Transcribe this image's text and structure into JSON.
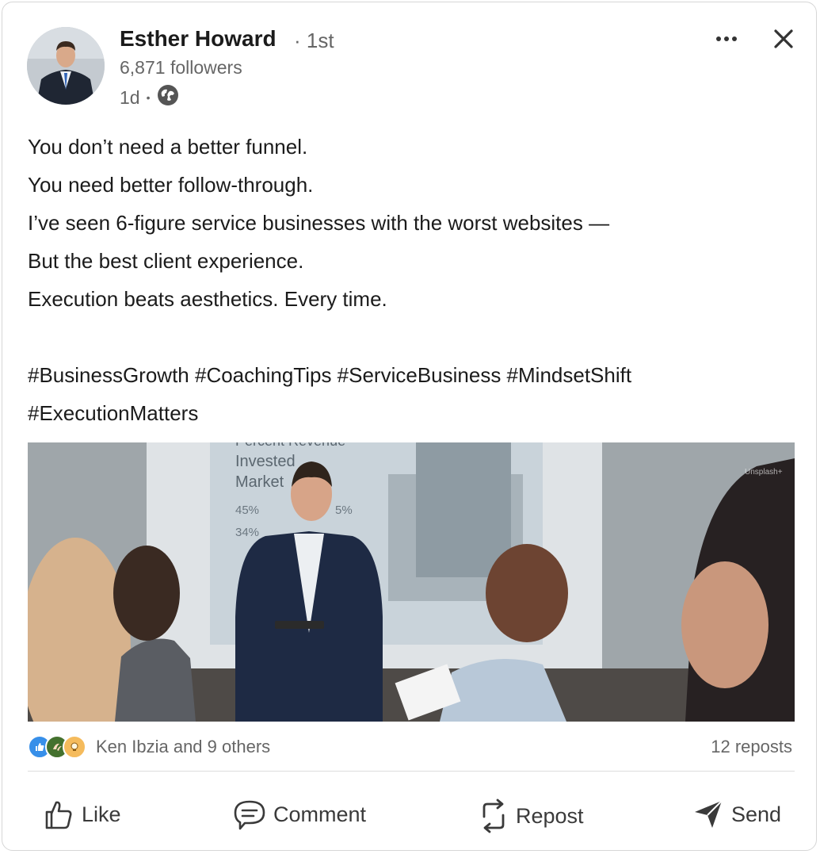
{
  "post": {
    "author": {
      "name": "Esther Howard",
      "degree": "· 1st",
      "followers": "6,871 followers",
      "time": "1d",
      "time_separator": "•",
      "visibility_icon": "globe-icon"
    },
    "menu_icon": "more-icon",
    "close_icon": "close-icon",
    "text_lines": [
      "You don’t need a better funnel.",
      "You need better follow-through.",
      "I’ve seen 6-figure service businesses with the worst websites —",
      "But the best client experience.",
      "Execution beats aesthetics. Every time."
    ],
    "hashtags_lines": [
      "#BusinessGrowth #CoachingTips #ServiceBusiness #MindsetShift",
      "#ExecutionMatters"
    ],
    "image": {
      "slide_lines": [
        "Percent Revenue",
        "Invested",
        "Market"
      ],
      "slide_stats": [
        "45%",
        "5%",
        "34%"
      ],
      "watermark": "Unsplash+"
    },
    "social": {
      "reaction_icons": [
        "like-icon",
        "celebrate-icon",
        "insightful-icon"
      ],
      "reactions_text": "Ken Ibzia and 9 others",
      "reposts_text": "12 reposts"
    },
    "actions": [
      {
        "label": "Like",
        "icon": "thumbs-up-icon"
      },
      {
        "label": "Comment",
        "icon": "comment-icon"
      },
      {
        "label": "Repost",
        "icon": "repost-icon"
      },
      {
        "label": "Send",
        "icon": "send-icon"
      }
    ],
    "colors": {
      "text": "#1b1b1b",
      "secondary": "#666666",
      "like_blue": "#378fe9",
      "celebrate_green": "#44712e",
      "insightful_yellow": "#f5bb5c"
    }
  }
}
